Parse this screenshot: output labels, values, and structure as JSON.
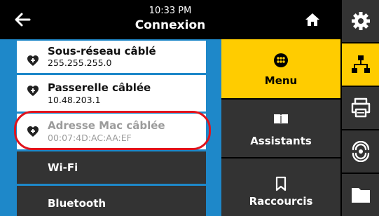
{
  "header": {
    "time": "10:33 PM",
    "title": "Connexion",
    "back_icon": "arrow-left-icon",
    "home_icon": "home-icon"
  },
  "list": {
    "items": [
      {
        "title": "Sous-réseau câblé",
        "value": "255.255.255.0",
        "icon": "heart-plus-icon",
        "enabled": true
      },
      {
        "title": "Passerelle câblée",
        "value": "10.48.203.1",
        "icon": "heart-plus-icon",
        "enabled": true
      },
      {
        "title": "Adresse Mac câblée",
        "value": "00:07:4D:AC:AA:EF",
        "icon": "heart-plus-icon",
        "enabled": false
      }
    ],
    "sections": [
      "Wi-Fi",
      "Bluetooth"
    ]
  },
  "nav": {
    "items": [
      {
        "label": "Menu",
        "icon": "menu-dots-icon",
        "active": true
      },
      {
        "label": "Assistants",
        "icon": "book-icon",
        "active": false
      },
      {
        "label": "Raccourcis",
        "icon": "bookmark-icon",
        "active": false
      }
    ]
  },
  "side": {
    "items": [
      {
        "icon": "gear-icon",
        "active": false
      },
      {
        "icon": "network-icon",
        "active": true
      },
      {
        "icon": "printer-icon",
        "active": false
      },
      {
        "icon": "sensor-icon",
        "active": false
      },
      {
        "icon": "folder-icon",
        "active": false
      }
    ]
  },
  "colors": {
    "accent": "#ffcc00",
    "list_border": "#1e88c9",
    "highlight": "#e0131c",
    "panel_dark": "#333333"
  }
}
